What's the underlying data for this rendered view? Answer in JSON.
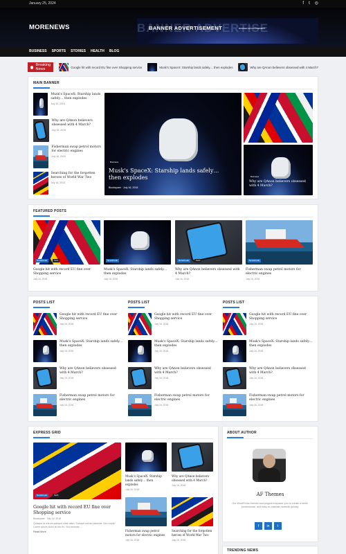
{
  "topbar": {
    "date": "January 25, 2024",
    "social_icons": [
      "facebook-icon",
      "twitter-icon",
      "instagram-icon"
    ]
  },
  "header": {
    "logo": "MORENEWS",
    "banner_title": "BANNER ADVERTISEMENT",
    "banner_sub": "BANNER ADVERTISEMENT"
  },
  "nav": {
    "items": [
      "BUSINESS",
      "SPORTS",
      "STORIES",
      "HEALTH",
      "BLOG"
    ]
  },
  "ticker": {
    "label": "Breaking News",
    "items": [
      "Google hit with record EU fine over Shopping service",
      "Musk's SpaceX: Starship lands safely… then explodes",
      "Why are QAnon believers obsessed with 4 March?"
    ]
  },
  "main_banner": {
    "heading": "MAIN BANNER",
    "list": [
      {
        "title": "Musk's SpaceX: Starship lands safely… then explodes",
        "date": "July 16, 2018"
      },
      {
        "title": "Why are QAnon believers obsessed with 4 March?",
        "date": "July 16, 2018"
      },
      {
        "title": "Fisherman swap petrol motors for electric engines",
        "date": "July 16, 2018"
      },
      {
        "title": "Searching for the forgotten heroes of World War Two",
        "date": "July 16, 2018"
      }
    ],
    "feature": {
      "tag": "Business",
      "title": "Musk's SpaceX: Starship lands safely… then explodes",
      "author": "Blockspare",
      "date": "July 16, 2018"
    },
    "side": {
      "tag": "Business",
      "title": "Why are QAnon believers obsessed with 4 March?",
      "author": "Blockspare",
      "date": "July 16, 2018"
    }
  },
  "featured": {
    "heading": "FEATURED POSTS",
    "items": [
      {
        "title": "Google hit with record EU fine over Shopping service",
        "date": "July 16, 2018",
        "tags": [
          "Newsbreak",
          "Tech"
        ]
      },
      {
        "title": "Musk's SpaceX: Starship lands safely… then explodes",
        "date": "July 16, 2018",
        "tags": [
          "Newsbreak"
        ]
      },
      {
        "title": "Why are QAnon believers obsessed with 4 March?",
        "date": "July 16, 2018",
        "tags": [
          "Newsbreak",
          "Tech"
        ]
      },
      {
        "title": "Fisherman swap petrol motors for electric engines",
        "date": "July 16, 2018",
        "tags": [
          "Newsbreak"
        ]
      }
    ]
  },
  "posts_list": {
    "heading": "POSTS LIST",
    "items": [
      {
        "title": "Google hit with record EU fine over Shopping service",
        "date": "July 16, 2018"
      },
      {
        "title": "Musk's SpaceX: Starship lands safely… then explodes",
        "date": "July 16, 2018"
      },
      {
        "title": "Why are QAnon believers obsessed with 4 March?",
        "date": "July 16, 2018"
      },
      {
        "title": "Fisherman swap petrol motors for electric engines",
        "date": "July 16, 2018"
      }
    ]
  },
  "express": {
    "heading": "EXPRESS GRID",
    "big": {
      "title": "Google hit with record EU fine over Shopping service",
      "author": "Blockspare",
      "date": "July 16, 2018",
      "excerpt": "Quisque id rutrum quisque vitae diam. Suscipit rutrum placerat. Nec turpis! Lorem ipsum dolor sit leo ex. You beneats...",
      "read_more": "Read More",
      "tags": [
        "Newsbreak",
        "Tech"
      ]
    },
    "small": [
      {
        "title": "Musk's SpaceX: Starship lands safely… then explodes",
        "date": "July 16, 2018"
      },
      {
        "title": "Why are QAnon believers obsessed with 4 March?",
        "date": "July 16, 2018"
      },
      {
        "title": "Fisherman swap petrol motors for electric engines",
        "date": "July 16, 2018"
      },
      {
        "title": "Searching for the forgotten heroes of World War Two",
        "date": "July 16, 2018"
      }
    ]
  },
  "about": {
    "heading": "ABOUT AUTHOR",
    "name": "AF Themes",
    "bio": "Our WordPress themes and plugins empower you to create a sleek, professional, and easy-to-maintain website quickly.",
    "socials": [
      "f",
      "in",
      "t"
    ]
  },
  "trending": {
    "heading": "TRENDING NEWS"
  }
}
